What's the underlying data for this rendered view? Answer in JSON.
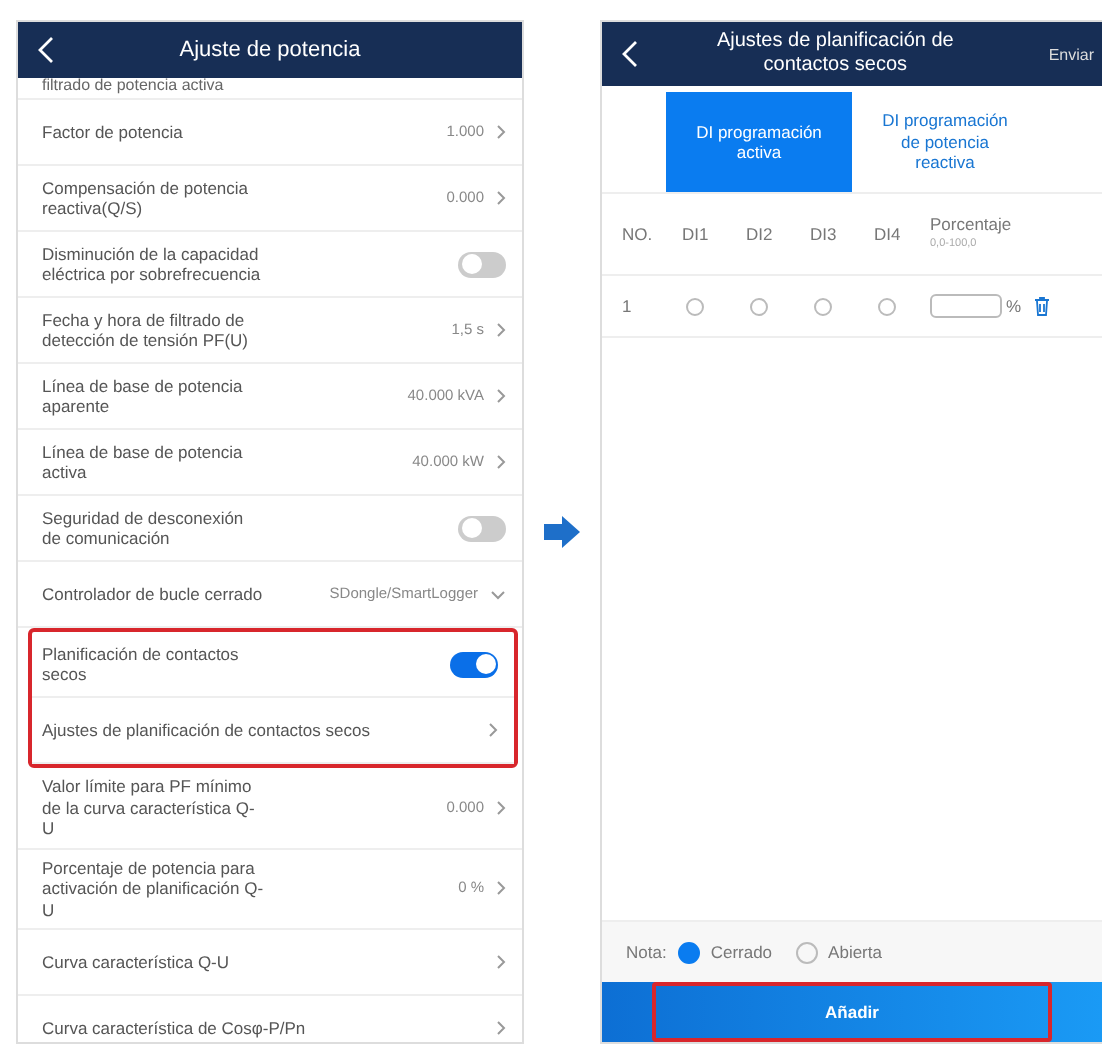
{
  "settings_screen": {
    "title": "Ajuste de potencia",
    "partial_item": "filtrado de potencia activa",
    "items": [
      {
        "kind": "value",
        "label": "Factor de potencia",
        "value": "1.000",
        "highlighted": false
      },
      {
        "kind": "value",
        "label": "Compensación de potencia reactiva(Q/S)",
        "value": "0.000",
        "highlighted": false
      },
      {
        "kind": "toggle",
        "label": "Disminución de la capacidad eléctrica por sobrefrecuencia",
        "on": false,
        "highlighted": false
      },
      {
        "kind": "value",
        "label": "Fecha y hora de filtrado de detección de tensión PF(U)",
        "value": "1,5 s",
        "highlighted": false
      },
      {
        "kind": "value",
        "label": "Línea de base de potencia aparente",
        "value": "40.000 kVA",
        "highlighted": false
      },
      {
        "kind": "value",
        "label": "Línea de base de potencia activa",
        "value": "40.000 kW",
        "highlighted": false
      },
      {
        "kind": "toggle",
        "label": "Seguridad de desconexión de comunicación",
        "on": false,
        "highlighted": false
      },
      {
        "kind": "dropdown",
        "label": "Controlador de bucle cerrado",
        "value": "SDongle/SmartLogger",
        "highlighted": false
      },
      {
        "kind": "toggle",
        "label": "Planificación de contactos secos",
        "on": true,
        "highlighted": true
      },
      {
        "kind": "link",
        "label": "Ajustes de planificación de contactos secos",
        "highlighted": true
      },
      {
        "kind": "value",
        "label": "Valor límite para PF mínimo de la curva característica Q-U",
        "value": "0.000",
        "highlighted": false
      },
      {
        "kind": "value",
        "label": "Porcentaje de potencia para activación de planificación Q-U",
        "value": "0 %",
        "highlighted": false
      },
      {
        "kind": "link",
        "label": "Curva característica Q-U",
        "highlighted": false
      },
      {
        "kind": "link",
        "label": "Curva característica de Cosφ-P/Pn",
        "highlighted": false
      }
    ]
  },
  "schedule_screen": {
    "title": "Ajustes de planificación de contactos secos",
    "action": "Enviar",
    "tabs": [
      {
        "label": "DI programación activa",
        "selected": true
      },
      {
        "label": "DI programación de potencia reactiva",
        "selected": false
      }
    ],
    "columns": [
      "NO.",
      "DI1",
      "DI2",
      "DI3",
      "DI4"
    ],
    "percent_column": {
      "label": "Porcentaje",
      "range": "0,0-100,0"
    },
    "rows": [
      {
        "no": "1",
        "di": [
          {
            "checked": false
          },
          {
            "checked": false
          },
          {
            "checked": false
          },
          {
            "checked": false
          }
        ],
        "unit": "%"
      }
    ],
    "note": {
      "label": "Nota:",
      "options": [
        {
          "label": "Cerrado",
          "selected": true
        },
        {
          "label": "Abierta",
          "selected": false
        }
      ]
    },
    "add_button": {
      "label": "Añadir",
      "highlighted": true
    }
  }
}
